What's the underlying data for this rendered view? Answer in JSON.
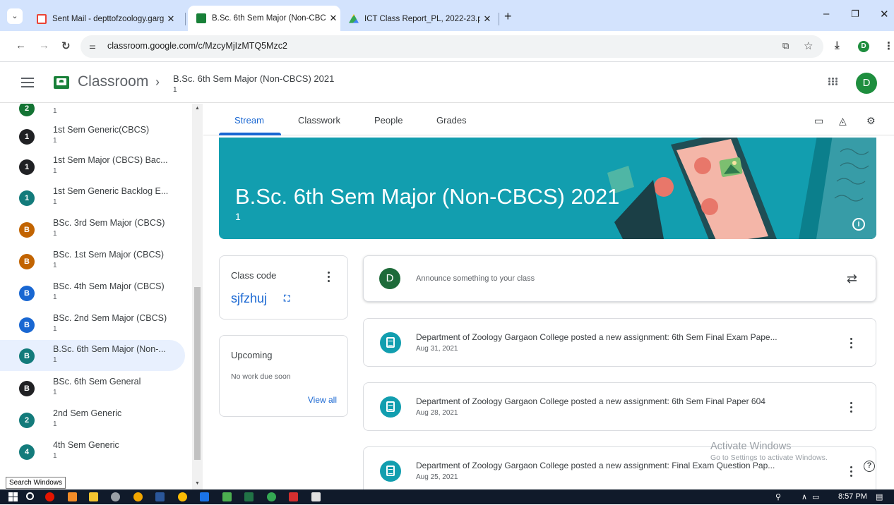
{
  "browser": {
    "tabs": [
      {
        "title": "Sent Mail - depttofzoology.garg",
        "close": "✕"
      },
      {
        "title": "B.Sc. 6th Sem Major (Non-CBCS",
        "close": "✕"
      },
      {
        "title": "ICT Class Report_PL, 2022-23.p",
        "close": "✕"
      }
    ],
    "new_tab": "+",
    "url": "classroom.google.com/c/MzcyMjIzMTQ5Mzc2",
    "profile_initial": "D"
  },
  "app": {
    "brand": "Classroom",
    "class_title": "B.Sc. 6th Sem Major (Non-CBCS) 2021",
    "class_section": "1",
    "account_initial": "D"
  },
  "sidebar": {
    "items": [
      {
        "name": "",
        "section": "1",
        "initial": "2",
        "color": "#137333"
      },
      {
        "name": "1st Sem Generic(CBCS)",
        "section": "1",
        "initial": "1",
        "color": "#202124"
      },
      {
        "name": "1st Sem Major (CBCS) Bac...",
        "section": "1",
        "initial": "1",
        "color": "#202124"
      },
      {
        "name": "1st Sem Generic Backlog E...",
        "section": "1",
        "initial": "1",
        "color": "#137b7b"
      },
      {
        "name": "BSc. 3rd Sem Major (CBCS)",
        "section": "1",
        "initial": "B",
        "color": "#c26401"
      },
      {
        "name": "BSc. 1st Sem Major (CBCS)",
        "section": "1",
        "initial": "B",
        "color": "#c26401"
      },
      {
        "name": "BSc. 4th Sem Major (CBCS)",
        "section": "1",
        "initial": "B",
        "color": "#1967d2"
      },
      {
        "name": "BSc. 2nd Sem Major (CBCS)",
        "section": "1",
        "initial": "B",
        "color": "#1967d2"
      },
      {
        "name": "B.Sc. 6th Sem Major (Non-...",
        "section": "1",
        "initial": "B",
        "color": "#137b7b"
      },
      {
        "name": "BSc. 6th Sem General",
        "section": "1",
        "initial": "B",
        "color": "#202124"
      },
      {
        "name": "2nd Sem Generic",
        "section": "1",
        "initial": "2",
        "color": "#137b7b"
      },
      {
        "name": "4th Sem Generic",
        "section": "1",
        "initial": "4",
        "color": "#137b7b"
      }
    ]
  },
  "tabs": {
    "stream": "Stream",
    "classwork": "Classwork",
    "people": "People",
    "grades": "Grades"
  },
  "class_code": {
    "label": "Class code",
    "code": "sjfzhuj"
  },
  "upcoming": {
    "title": "Upcoming",
    "empty": "No work due soon",
    "link": "View all"
  },
  "announce": {
    "initial": "D",
    "placeholder": "Announce something to your class"
  },
  "posts": [
    {
      "title": "Department of Zoology Gargaon College posted a new assignment: 6th Sem Final Exam Pape...",
      "date": "Aug 31, 2021"
    },
    {
      "title": "Department of Zoology Gargaon College posted a new assignment: 6th Sem Final Paper 604",
      "date": "Aug 28, 2021"
    },
    {
      "title": "Department of Zoology Gargaon College posted a new assignment: Final Exam Question Pap...",
      "date": "Aug 25, 2021"
    }
  ],
  "watermark": {
    "line1": "Activate Windows",
    "line2": "Go to Settings to activate Windows."
  },
  "tooltip": "Search Windows",
  "taskbar": {
    "time": "8:57 PM"
  },
  "colors": {
    "accent": "#1967d2",
    "banner": "#129eaf",
    "avatar_green": "#1e8e3e"
  }
}
